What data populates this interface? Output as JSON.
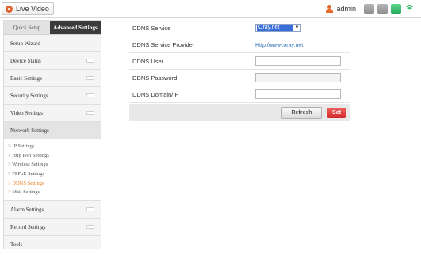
{
  "header": {
    "live_tab": "Live Video",
    "user": "admin",
    "icons": [
      "user-icon",
      "system-icon",
      "storage-icon",
      "sd-card-icon",
      "wifi-icon"
    ]
  },
  "sidebar": {
    "tabs": [
      "Quick Setup",
      "Advanced Settings"
    ],
    "items": [
      {
        "label": "Setup Wizard"
      },
      {
        "label": "Device Status"
      },
      {
        "label": "Basic Settings"
      },
      {
        "label": "Security Settings"
      },
      {
        "label": "Video Settings"
      },
      {
        "label": "Network Settings"
      }
    ],
    "submenu": [
      "> IP Settings",
      "> Http Port Settings",
      "> Wireless Settings",
      "> PPPoE Settings",
      "> DDNS Settings",
      "> Mail Settings"
    ],
    "items_after": [
      {
        "label": "Alarm Settings"
      },
      {
        "label": "Record Settings"
      },
      {
        "label": "Tools"
      }
    ]
  },
  "form": {
    "ddns_service_label": "DDNS Service",
    "ddns_service_value": "Oray.net",
    "ddns_provider_label": "DDNS Service Provider",
    "ddns_provider_value": "Http://www.oray.net",
    "ddns_user_label": "DDNS User",
    "ddns_user_value": "",
    "ddns_password_label": "DDNS Password",
    "ddns_password_value": "",
    "ddns_domain_label": "DDNS Domain/IP",
    "ddns_domain_value": "",
    "refresh_label": "Refresh",
    "set_label": "Set"
  },
  "colors": {
    "accent": "#e8801e",
    "set_button": "#d22a2a",
    "link": "#2a6fb0"
  }
}
